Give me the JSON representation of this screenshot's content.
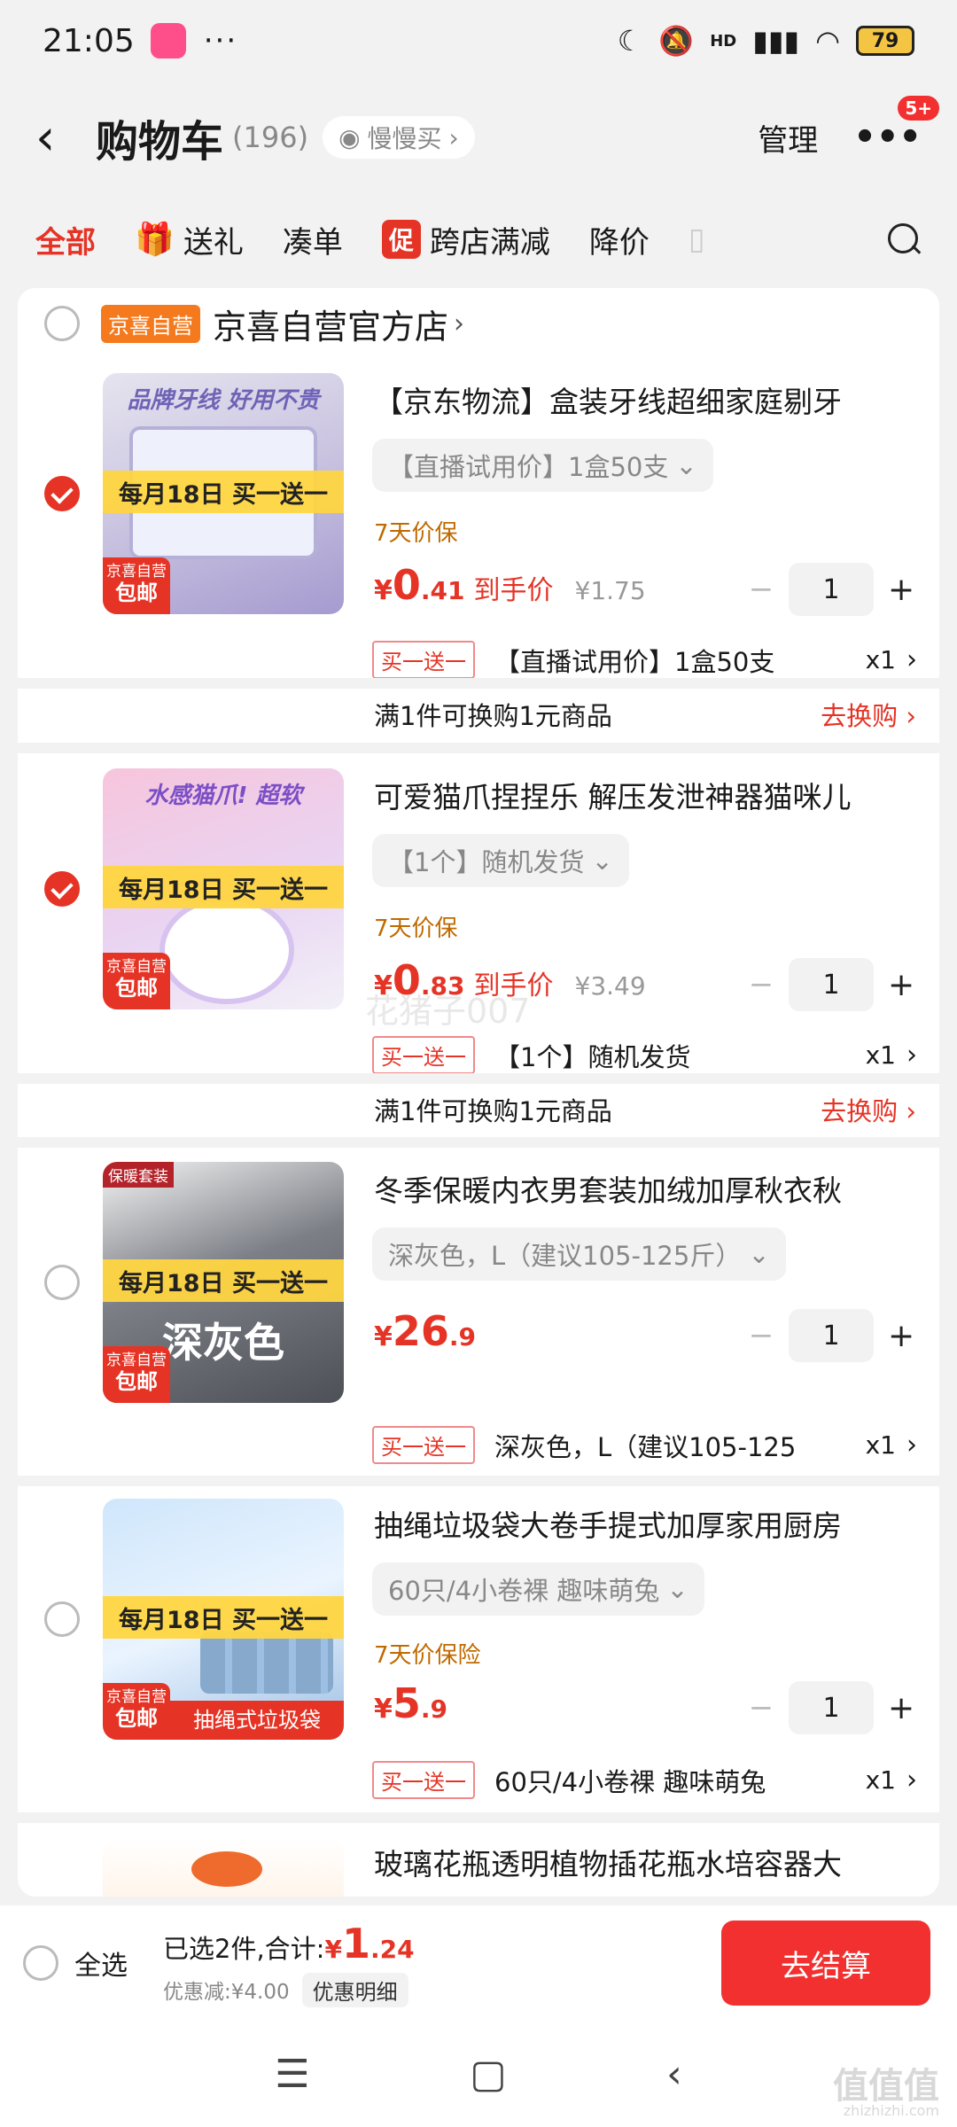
{
  "status_bar": {
    "time": "21:05",
    "battery": "79",
    "network": "HD",
    "more_dots": "···"
  },
  "header": {
    "back_icon": "chevron-left",
    "title": "购物车",
    "count": "(196)",
    "slow_buy_label": "慢慢买",
    "manage_label": "管理",
    "more_badge": "5+"
  },
  "tabs": [
    {
      "label": "全部",
      "active": true
    },
    {
      "label": "送礼",
      "icon": "gift"
    },
    {
      "label": "凑单"
    },
    {
      "label": "跨店满减",
      "icon": "促"
    },
    {
      "label": "降价"
    }
  ],
  "store": {
    "tag": "京喜自营",
    "name": "京喜自营官方店"
  },
  "common_badges": {
    "promo_strip": "每月18日 买一送一",
    "ship_top": "京喜自营",
    "ship_bottom": "包邮"
  },
  "items": [
    {
      "title": "【京东物流】盒装牙线超细家庭剔牙",
      "variant": "【直播试用价】1盒50支",
      "protection": "7天价保",
      "price_yen": "¥",
      "price_int": "0",
      "price_dec": ".41",
      "price_note": "到手价",
      "orig_price": "¥1.75",
      "qty": "1",
      "gift_tag": "买一送一",
      "gift_desc": "【直播试用价】1盒50支",
      "gift_qty": "x1",
      "swap_text": "满1件可换购1元商品",
      "swap_link": "去换购",
      "image_text": "品牌牙线 好用不贵",
      "checked": true
    },
    {
      "title": "可爱猫爪捏捏乐 解压发泄神器猫咪儿",
      "variant": "【1个】随机发货",
      "protection": "7天价保",
      "price_yen": "¥",
      "price_int": "0",
      "price_dec": ".83",
      "price_note": "到手价",
      "orig_price": "¥3.49",
      "qty": "1",
      "gift_tag": "买一送一",
      "gift_desc": "【1个】随机发货",
      "gift_qty": "x1",
      "swap_text": "满1件可换购1元商品",
      "swap_link": "去换购",
      "image_text": "水感猫爪! 超软",
      "checked": true
    },
    {
      "title": "冬季保暖内衣男套装加绒加厚秋衣秋",
      "variant": "深灰色，L（建议105-125斤）",
      "price_yen": "¥",
      "price_int": "26",
      "price_dec": ".9",
      "qty": "1",
      "gift_tag": "买一送一",
      "gift_desc": "深灰色，L（建议105-125",
      "gift_qty": "x1",
      "image_corner": "保暖套装",
      "image_big": "深灰色",
      "checked": false
    },
    {
      "title": "抽绳垃圾袋大卷手提式加厚家用厨房",
      "variant": "60只/4小卷裸 趣味萌兔",
      "protection": "7天价保险",
      "price_yen": "¥",
      "price_int": "5",
      "price_dec": ".9",
      "qty": "1",
      "gift_tag": "买一送一",
      "gift_desc": "60只/4小卷裸 趣味萌兔",
      "gift_qty": "x1",
      "image_bottom": "抽绳式垃圾袋",
      "checked": false
    },
    {
      "title": "玻璃花瓶透明植物插花瓶水培容器大",
      "checked": false
    }
  ],
  "bottom_bar": {
    "select_all": "全选",
    "selected_text": "已选2件,合计:",
    "total_yen": "¥",
    "total_int": "1",
    "total_dec": ".24",
    "discount_text": "优惠减:¥4.00",
    "detail_label": "优惠明细",
    "checkout_label": "去结算"
  },
  "watermarks": {
    "center": "花猪子007",
    "corner": "值值值",
    "corner_url": "zhizhizhi.com"
  },
  "colors": {
    "accent_red": "#e53426",
    "checkout_red": "#f23030",
    "store_tag_orange": "#f57a1e",
    "protection_brown": "#c06a00"
  }
}
